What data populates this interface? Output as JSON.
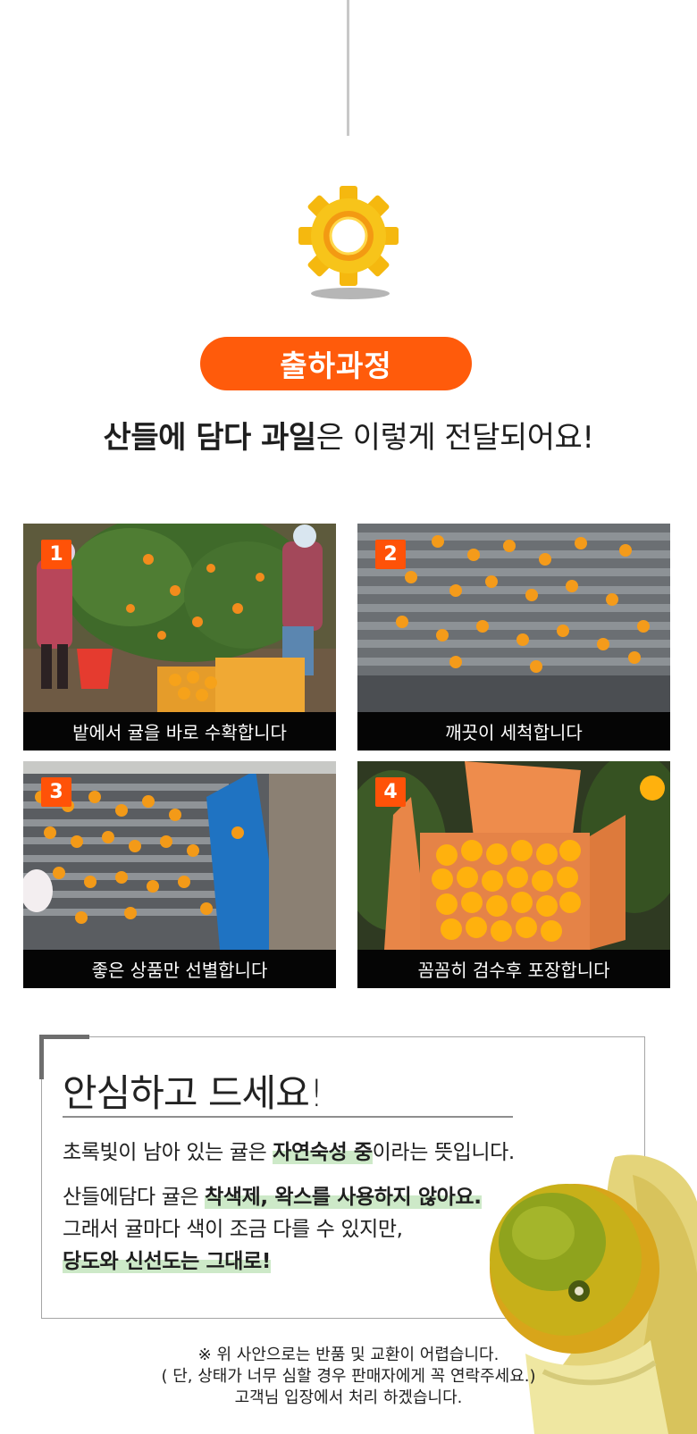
{
  "badge": {
    "label": "출하과정"
  },
  "headline": {
    "bold": "산들에 담다 과일",
    "normal": "은 이렇게 전달되어요!"
  },
  "steps": [
    {
      "number": "1",
      "caption": "밭에서 귤을 바로 수확합니다"
    },
    {
      "number": "2",
      "caption": "깨끗이 세척합니다"
    },
    {
      "number": "3",
      "caption": "좋은 상품만 선별합니다"
    },
    {
      "number": "4",
      "caption": "꼼꼼히 검수후 포장합니다"
    }
  ],
  "note": {
    "title": "안심하고 드세요!",
    "line1_pre": "초록빛이 남아 있는 귤은 ",
    "line1_highlight": "자연숙성 중",
    "line1_post": "이라는 뜻입니다.",
    "line2_pre": "산들에담다 귤은 ",
    "line2_highlight": "착색제, 왁스를 사용하지 않아요.",
    "line3": "그래서 귤마다 색이 조금 다를 수 있지만,",
    "line4_highlight": "당도와 신선도는 그대로!"
  },
  "footer": {
    "line1": "※ 위 사안으로는 반품 및 교환이 어렵습니다.",
    "line2": "( 단, 상태가 너무 심할 경우 판매자에게 꼭 연락주세요.)",
    "line3": "고객님 입장에서 처리 하겠습니다."
  },
  "colors": {
    "accent": "#ff5b0b",
    "highlight": "#cde9c8",
    "gear": "#f7c117"
  },
  "icons": [
    "gear-icon"
  ]
}
